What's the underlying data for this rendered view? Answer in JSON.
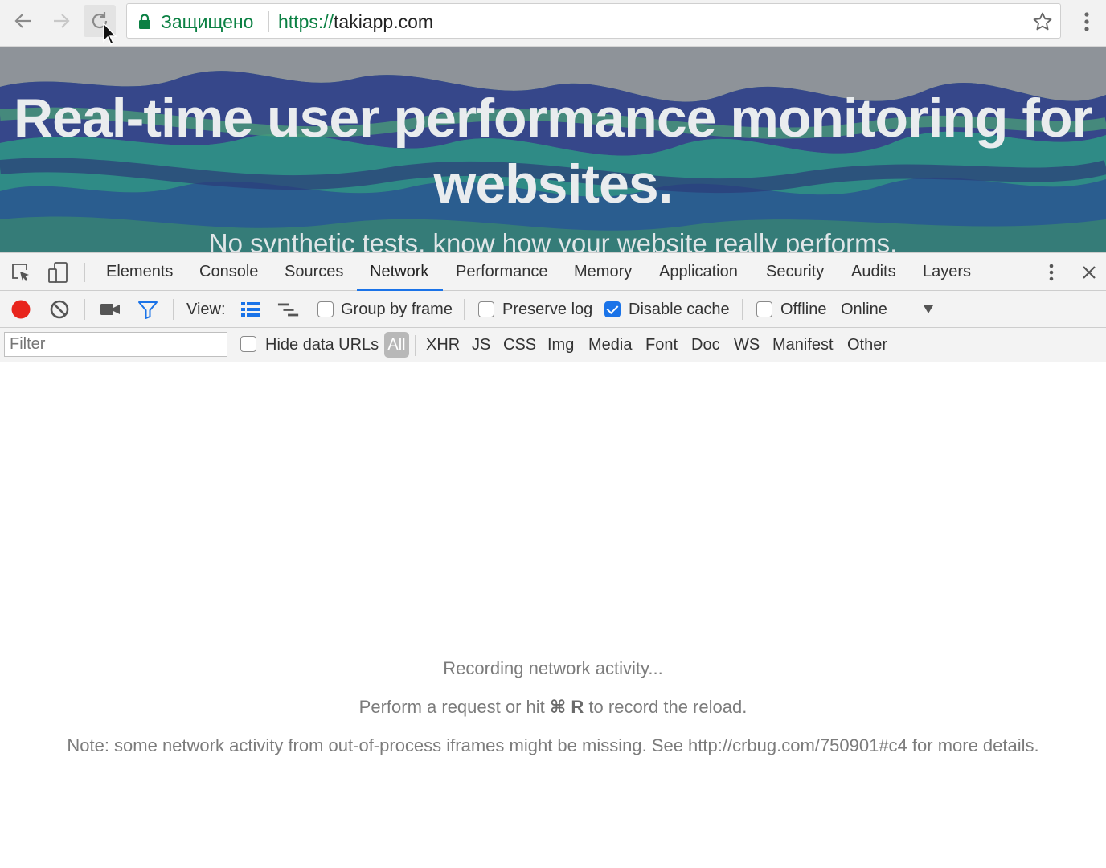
{
  "browser": {
    "secure_label": "Защищено",
    "url_scheme": "https://",
    "url_host": "takiapp.com"
  },
  "hero": {
    "title_line1": "Real-time user performance monitoring for",
    "title_line2": "websites.",
    "subtitle": "No synthetic tests, know how your website really performs."
  },
  "devtools": {
    "tabs": [
      "Elements",
      "Console",
      "Sources",
      "Network",
      "Performance",
      "Memory",
      "Application",
      "Security",
      "Audits",
      "Layers"
    ],
    "active_tab": "Network",
    "toolbar": {
      "view_label": "View:",
      "group_by_frame": "Group by frame",
      "preserve_log": "Preserve log",
      "disable_cache": "Disable cache",
      "offline": "Offline",
      "throttling": "Online"
    },
    "filterbar": {
      "filter_placeholder": "Filter",
      "hide_data_urls": "Hide data URLs",
      "types": [
        "All",
        "XHR",
        "JS",
        "CSS",
        "Img",
        "Media",
        "Font",
        "Doc",
        "WS",
        "Manifest",
        "Other"
      ]
    },
    "empty": {
      "line1": "Recording network activity...",
      "line2_before": "Perform a request or hit ",
      "line2_key": "⌘ R",
      "line2_after": " to record the reload.",
      "line3": "Note: some network activity from out-of-process iframes might be missing. See http://crbug.com/750901#c4 for more details."
    }
  },
  "colors": {
    "secure_green": "#0b8043",
    "accent_blue": "#1a73e8",
    "record_red": "#e8251d"
  },
  "icons": [
    "back-arrow-icon",
    "forward-arrow-icon",
    "reload-icon",
    "lock-icon",
    "star-icon",
    "menu-dots-icon",
    "inspect-icon",
    "device-toggle-icon",
    "record-icon",
    "clear-icon",
    "screenshot-camera-icon",
    "filter-funnel-icon",
    "list-view-icon",
    "waterfall-view-icon",
    "dropdown-arrow-icon",
    "close-icon"
  ]
}
